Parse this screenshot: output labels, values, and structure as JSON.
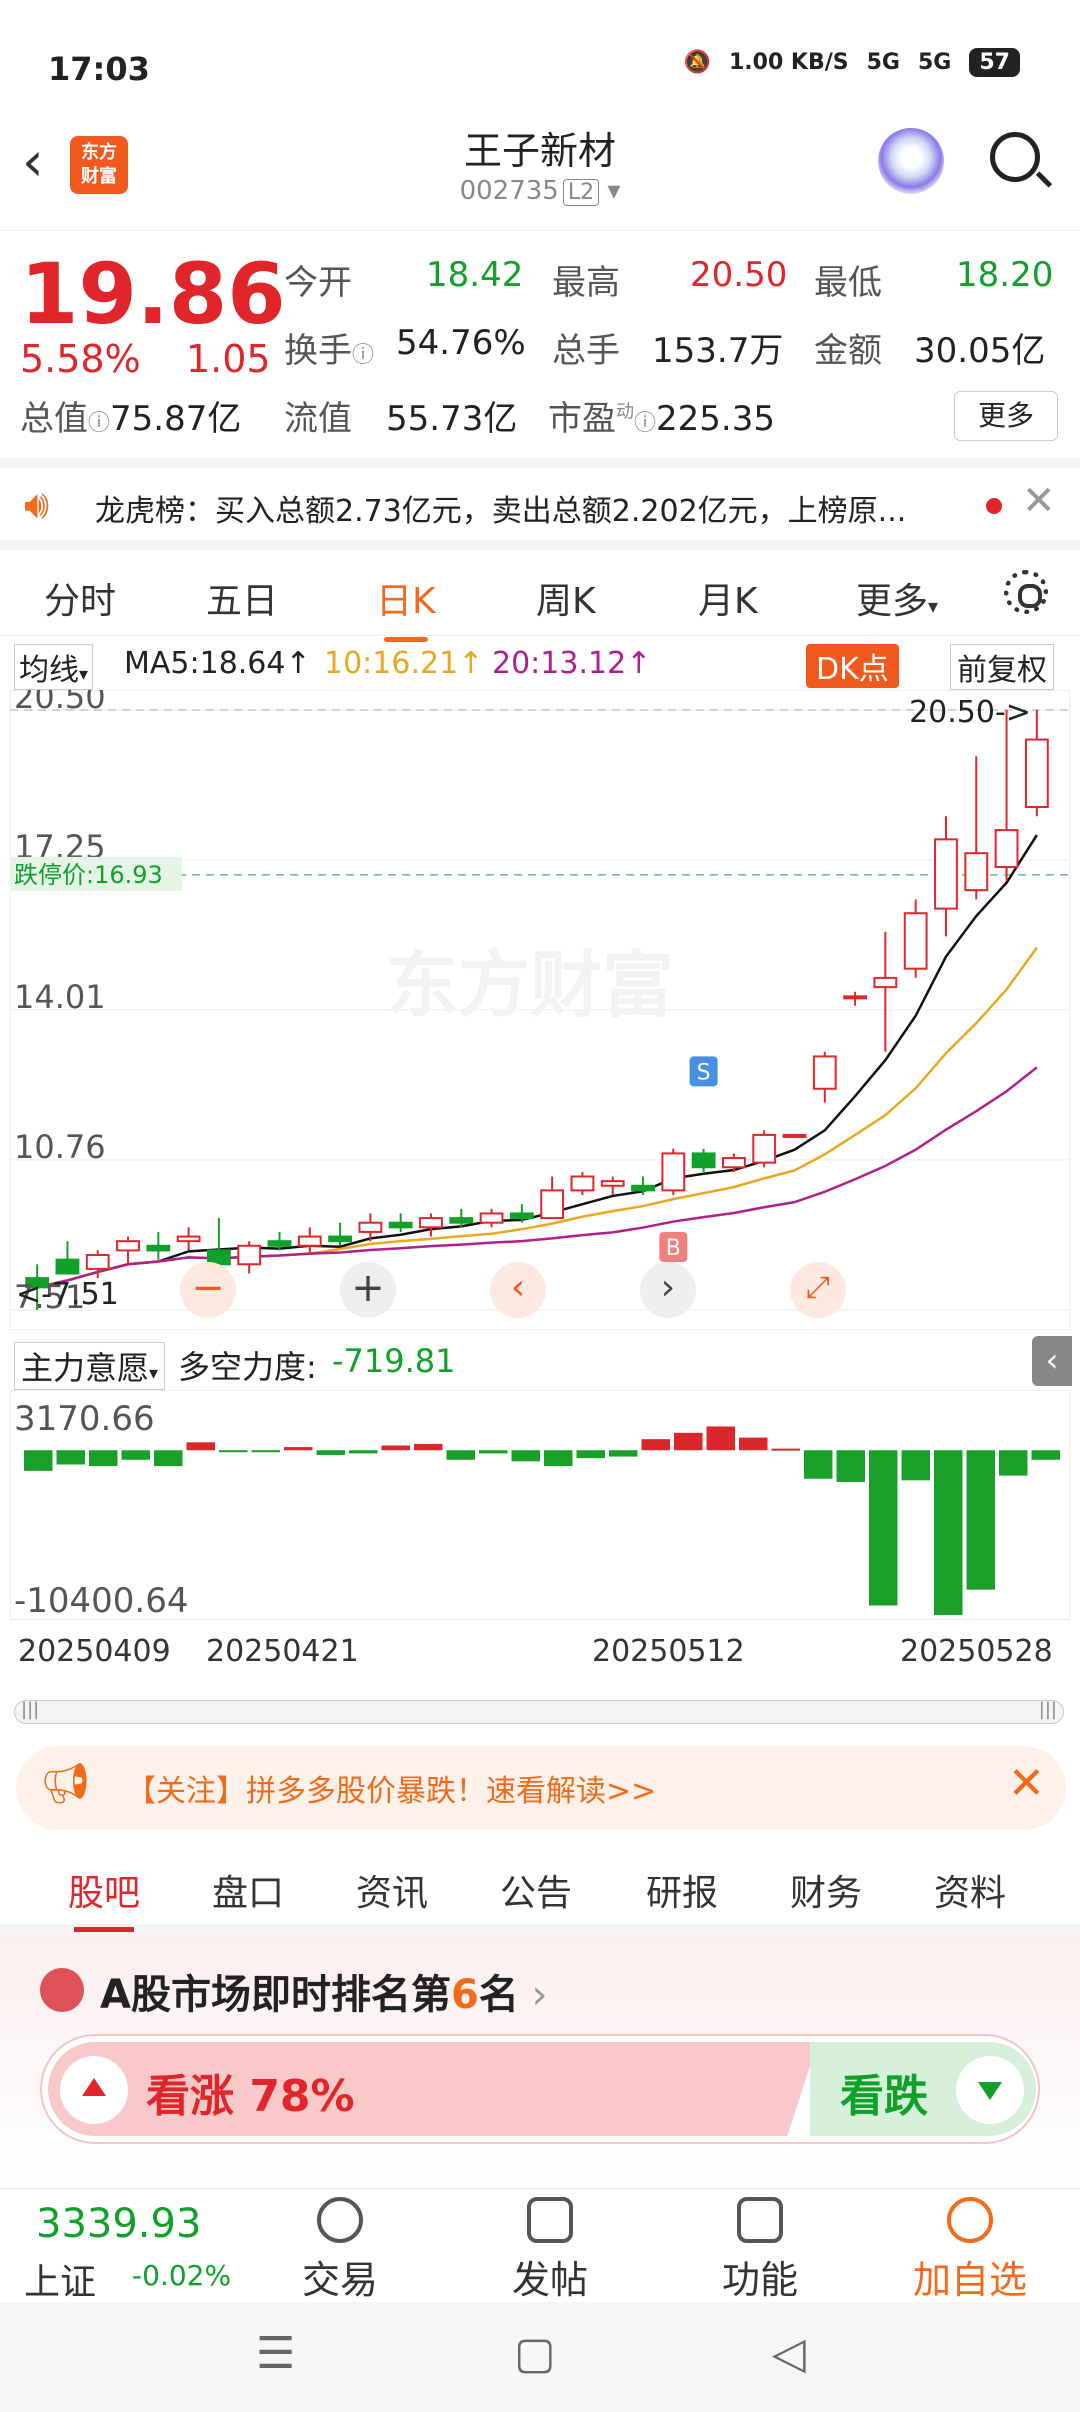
{
  "status_bar": {
    "time": "17:03",
    "speed": "1.00 KB/S",
    "net1": "5G",
    "net2": "5G",
    "battery": "57"
  },
  "nav": {
    "logo_text": "东方 财富",
    "title": "王子新材",
    "code": "002735",
    "level": "L2"
  },
  "quote": {
    "price": "19.86",
    "change_pct": "5.58%",
    "change": "1.05",
    "open_label": "今开",
    "open": "18.42",
    "high_label": "最高",
    "high": "20.50",
    "low_label": "最低",
    "low": "18.20",
    "turnover_label": "换手",
    "turnover": "54.76%",
    "volume_label": "总手",
    "volume": "153.7万",
    "amount_label": "金额",
    "amount": "30.05亿",
    "mktcap_label": "总值",
    "mktcap": "75.87亿",
    "float_label": "流值",
    "float": "55.73亿",
    "pe_label": "市盈",
    "pe_sup": "动",
    "pe": "225.35",
    "more": "更多"
  },
  "notice": {
    "text": "龙虎榜：买入总额2.73亿元，卖出总额2.202亿元，上榜原..."
  },
  "tabs": [
    "分时",
    "五日",
    "日K",
    "周K",
    "月K",
    "更多"
  ],
  "ma": {
    "selector": "均线",
    "ma5": "MA5:18.64",
    "ma10": "10:16.21",
    "ma20": "20:13.12",
    "dk": "DK点",
    "adjust": "前复权"
  },
  "chart_data": {
    "type": "candlestick",
    "ylim": [
      7.51,
      20.5
    ],
    "y_ticks": [
      "20.50",
      "17.25",
      "14.01",
      "10.76",
      "7.51"
    ],
    "limit_down_label": "跌停价:16.93",
    "limit_down": 16.93,
    "high_marker": "20.50->",
    "low_marker": "<-7.51",
    "watermark": "东方财富",
    "markers": {
      "s": "S",
      "b": "B"
    },
    "candles": [
      {
        "o": 8.2,
        "h": 8.5,
        "l": 7.51,
        "c": 8.0
      },
      {
        "o": 8.6,
        "h": 9.0,
        "l": 8.3,
        "c": 8.3
      },
      {
        "o": 8.4,
        "h": 8.8,
        "l": 8.2,
        "c": 8.7
      },
      {
        "o": 8.8,
        "h": 9.1,
        "l": 8.5,
        "c": 9.0
      },
      {
        "o": 8.9,
        "h": 9.2,
        "l": 8.6,
        "c": 8.8
      },
      {
        "o": 9.0,
        "h": 9.3,
        "l": 8.8,
        "c": 9.1
      },
      {
        "o": 8.8,
        "h": 9.5,
        "l": 8.6,
        "c": 8.5
      },
      {
        "o": 8.5,
        "h": 9.0,
        "l": 8.3,
        "c": 8.9
      },
      {
        "o": 9.0,
        "h": 9.2,
        "l": 8.8,
        "c": 8.9
      },
      {
        "o": 8.9,
        "h": 9.3,
        "l": 8.7,
        "c": 9.1
      },
      {
        "o": 9.1,
        "h": 9.4,
        "l": 8.9,
        "c": 9.0
      },
      {
        "o": 9.2,
        "h": 9.6,
        "l": 9.0,
        "c": 9.4
      },
      {
        "o": 9.4,
        "h": 9.6,
        "l": 9.2,
        "c": 9.3
      },
      {
        "o": 9.3,
        "h": 9.6,
        "l": 9.1,
        "c": 9.5
      },
      {
        "o": 9.5,
        "h": 9.7,
        "l": 9.3,
        "c": 9.4
      },
      {
        "o": 9.4,
        "h": 9.7,
        "l": 9.3,
        "c": 9.6
      },
      {
        "o": 9.6,
        "h": 9.8,
        "l": 9.4,
        "c": 9.5
      },
      {
        "o": 9.5,
        "h": 10.4,
        "l": 9.5,
        "c": 10.1
      },
      {
        "o": 10.1,
        "h": 10.5,
        "l": 10.0,
        "c": 10.4
      },
      {
        "o": 10.2,
        "h": 10.4,
        "l": 10.0,
        "c": 10.3
      },
      {
        "o": 10.2,
        "h": 10.4,
        "l": 10.0,
        "c": 10.1
      },
      {
        "o": 10.1,
        "h": 11.0,
        "l": 10.0,
        "c": 10.9
      },
      {
        "o": 10.9,
        "h": 11.0,
        "l": 10.5,
        "c": 10.6
      },
      {
        "o": 10.6,
        "h": 10.9,
        "l": 10.5,
        "c": 10.8
      },
      {
        "o": 10.7,
        "h": 11.4,
        "l": 10.6,
        "c": 11.3
      },
      {
        "o": 11.3,
        "h": 11.3,
        "l": 11.3,
        "c": 11.3
      },
      {
        "o": 12.3,
        "h": 13.1,
        "l": 12.0,
        "c": 13.0
      },
      {
        "o": 14.3,
        "h": 14.4,
        "l": 14.1,
        "c": 14.3
      },
      {
        "o": 14.5,
        "h": 15.7,
        "l": 13.1,
        "c": 14.7
      },
      {
        "o": 14.9,
        "h": 16.4,
        "l": 14.7,
        "c": 16.1
      },
      {
        "o": 16.2,
        "h": 18.2,
        "l": 15.6,
        "c": 17.7
      },
      {
        "o": 16.6,
        "h": 19.5,
        "l": 16.4,
        "c": 17.4
      },
      {
        "o": 17.1,
        "h": 20.5,
        "l": 16.8,
        "c": 17.9
      },
      {
        "o": 18.4,
        "h": 20.5,
        "l": 18.2,
        "c": 19.86
      }
    ],
    "volume_axis": [
      "3170.66",
      "-10400.64"
    ],
    "x_dates": [
      "20250409",
      "20250421",
      "20250512",
      "20250528"
    ]
  },
  "indicator": {
    "selector": "主力意愿",
    "label": "多空力度:",
    "value": "-719.81",
    "bars": [
      -1300,
      -900,
      -1000,
      -600,
      -1000,
      500,
      -100,
      -100,
      200,
      -300,
      -200,
      300,
      400,
      -600,
      -200,
      -700,
      -1000,
      -500,
      -400,
      700,
      1100,
      1500,
      800,
      100,
      -1800,
      -2000,
      -9800,
      -1900,
      -10400,
      -8800,
      -1600,
      -600
    ]
  },
  "banner": {
    "text": "【关注】拼多多股价暴跌！速看解读>>"
  },
  "subtabs": [
    "股吧",
    "盘口",
    "资讯",
    "公告",
    "研报",
    "财务",
    "资料"
  ],
  "rank": {
    "title_pre": "A股市场即时排名第",
    "rank": "6",
    "title_post": "名",
    "up": "看涨 78%",
    "down": "看跌",
    "up_ratio": 0.78
  },
  "bottom": {
    "index_value": "3339.93",
    "index_name": "上证",
    "index_change": "-0.02%",
    "items": [
      "交易",
      "发帖",
      "功能",
      "加自选"
    ]
  }
}
